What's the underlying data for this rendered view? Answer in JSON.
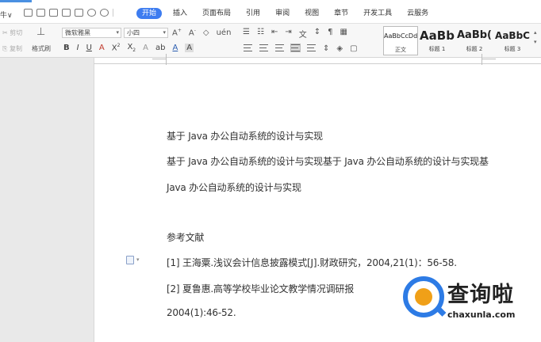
{
  "menubar": {
    "file_label": "牛∨",
    "tabs": [
      {
        "label": "开始",
        "active": true
      },
      {
        "label": "插入"
      },
      {
        "label": "页面布局"
      },
      {
        "label": "引用"
      },
      {
        "label": "审阅"
      },
      {
        "label": "视图"
      },
      {
        "label": "章节"
      },
      {
        "label": "开发工具"
      },
      {
        "label": "云服务"
      }
    ]
  },
  "ribbon": {
    "cut_label": "剪切",
    "copy_label": "复制",
    "format_painter_label": "格式刷",
    "font_name": "微软雅黑",
    "font_size": "小四",
    "styles": [
      {
        "preview": "AaBbCcDd",
        "label": "正文"
      },
      {
        "preview": "AaBb",
        "label": "标题 1"
      },
      {
        "preview": "AaBb(",
        "label": "标题 2"
      },
      {
        "preview": "AaBbC",
        "label": "标题 3"
      }
    ]
  },
  "document": {
    "lines": [
      "基于 Java 办公自动系统的设计与实现",
      "基于 Java 办公自动系统的设计与实现基于 Java 办公自动系统的设计与实现基",
      "Java 办公自动系统的设计与实现",
      "参考文献",
      "[1]  王海粟.浅议会计信息披露模式[J].财政研究，2004,21(1)：56-58.",
      "[2]  夏鲁惠.高等学校毕业论文教学情况调研报",
      "2004(1):46-52."
    ]
  },
  "watermark": {
    "brand_cn": "查询啦",
    "brand_url": "chaxunla.com",
    "colors": {
      "blue": "#2d7be5",
      "orange": "#f0a018"
    }
  },
  "colors": {
    "accent": "#3d7cf0"
  }
}
